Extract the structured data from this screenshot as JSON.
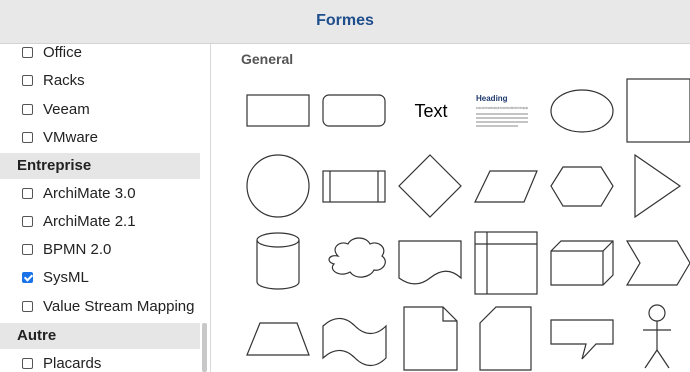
{
  "header": {
    "title": "Formes"
  },
  "sidebar": {
    "items": [
      {
        "label": "Office",
        "checked": false
      },
      {
        "label": "Racks",
        "checked": false
      },
      {
        "label": "Veeam",
        "checked": false
      },
      {
        "label": "VMware",
        "checked": false
      }
    ],
    "sections": [
      {
        "title": "Entreprise",
        "items": [
          {
            "label": "ArchiMate 3.0",
            "checked": false
          },
          {
            "label": "ArchiMate 2.1",
            "checked": false
          },
          {
            "label": "BPMN 2.0",
            "checked": false
          },
          {
            "label": "SysML",
            "checked": true
          },
          {
            "label": "Value Stream Mapping",
            "checked": false
          }
        ]
      },
      {
        "title": "Autre",
        "items": [
          {
            "label": "Placards",
            "checked": false
          }
        ]
      }
    ]
  },
  "gallery": {
    "title": "General",
    "text_shape_label": "Text",
    "heading_shape": {
      "heading": "Heading",
      "body": "Lorem ipsum dolor sit amet consectetur adipiscing elit sed do eiusmod tempor incididunt ut labore et dolore magna aliqua"
    },
    "shape_icons": [
      "rectangle-shape",
      "rounded-rectangle-shape",
      "text-shape",
      "heading-text-shape",
      "ellipse-shape",
      "square-shape",
      "circle-shape",
      "process-shape",
      "diamond-shape",
      "parallelogram-shape",
      "hexagon-shape",
      "triangle-shape",
      "cylinder-shape",
      "cloud-shape",
      "document-shape",
      "internal-storage-shape",
      "cube-shape",
      "step-shape",
      "trapezoid-shape",
      "tape-shape",
      "note-shape",
      "card-shape",
      "callout-shape",
      "actor-shape"
    ]
  }
}
